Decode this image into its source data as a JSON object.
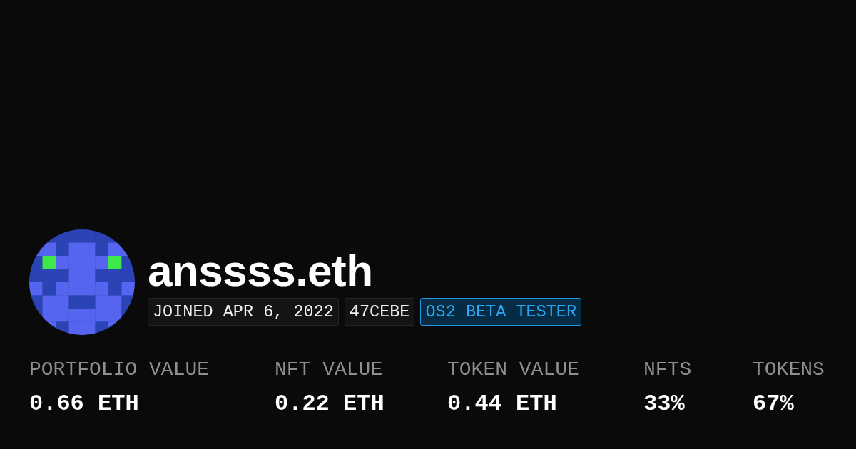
{
  "profile": {
    "name": "anssss.eth",
    "badges": [
      {
        "text": "JOINED APR 6, 2022",
        "kind": "plain"
      },
      {
        "text": "47CEBE",
        "kind": "plain"
      },
      {
        "text": "OS2 BETA TESTER",
        "kind": "highlight"
      }
    ]
  },
  "stats": [
    {
      "label": "PORTFOLIO VALUE",
      "value": "0.66 ETH"
    },
    {
      "label": "NFT VALUE",
      "value": "0.22 ETH"
    },
    {
      "label": "TOKEN VALUE",
      "value": "0.44 ETH"
    },
    {
      "label": "NFTS",
      "value": "33%"
    },
    {
      "label": "TOKENS",
      "value": "67%"
    }
  ]
}
